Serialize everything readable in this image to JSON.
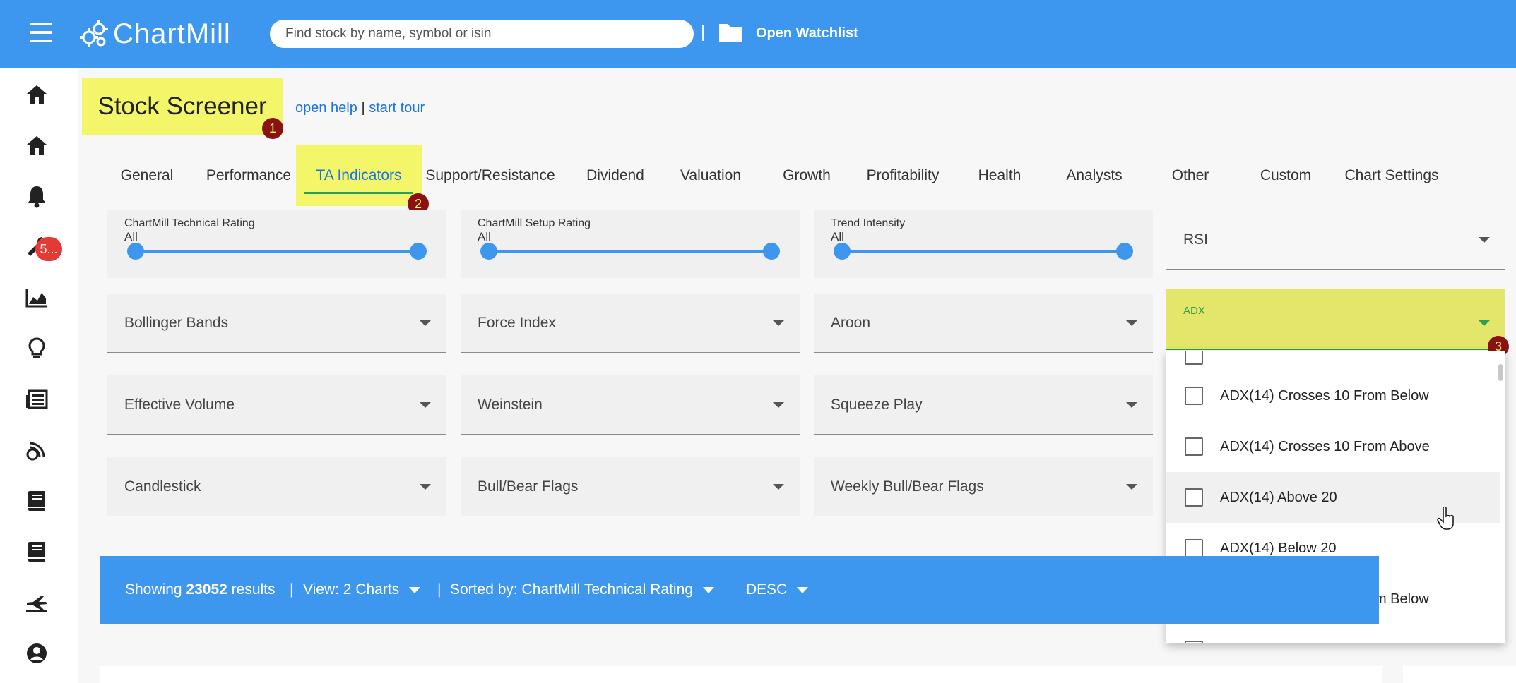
{
  "header": {
    "logo_text": "ChartMill",
    "search_placeholder": "Find stock by name, symbol or isin",
    "separator": "|",
    "open_watchlist": "Open Watchlist"
  },
  "sidebar": {
    "notifications_badge": "5...",
    "icons": [
      "home-icon",
      "home-icon",
      "bell-icon",
      "wrench-icon",
      "area-chart-icon",
      "lightbulb-icon",
      "newspaper-icon",
      "blog-icon",
      "book-icon",
      "book-icon",
      "plane-icon",
      "user-icon"
    ]
  },
  "page": {
    "title": "Stock Screener",
    "open_help": "open help",
    "separator": "|",
    "start_tour": "start tour",
    "markers": [
      "1",
      "2",
      "3"
    ]
  },
  "tabs": [
    "General",
    "Performance",
    "TA Indicators",
    "Support/Resistance",
    "Dividend",
    "Valuation",
    "Growth",
    "Profitability",
    "Health",
    "Analysts",
    "Other",
    "Custom",
    "Chart Settings"
  ],
  "active_tab": "TA Indicators",
  "sliders": [
    {
      "label": "ChartMill Technical Rating",
      "value": "All",
      "min_fraction": 0,
      "max_fraction": 1
    },
    {
      "label": "ChartMill Setup Rating",
      "value": "All",
      "min_fraction": 0,
      "max_fraction": 1
    },
    {
      "label": "Trend Intensity",
      "value": "All",
      "min_fraction": 0,
      "max_fraction": 1
    }
  ],
  "selects": {
    "rsi": "RSI",
    "row1": [
      "Bollinger Bands",
      "Force Index",
      "Aroon"
    ],
    "row2": [
      "Effective Volume",
      "Weinstein",
      "Squeeze Play"
    ],
    "row3": [
      "Candlestick",
      "Bull/Bear Flags",
      "Weekly Bull/Bear Flags"
    ],
    "adx_label": "ADX"
  },
  "adx_options": [
    "ADX(14) Crosses 10 From Below",
    "ADX(14) Crosses 10 From Above",
    "ADX(14) Above 20",
    "ADX(14) Below 20",
    "ADX(14) Crosses 20 From Below"
  ],
  "results": {
    "showing_prefix": "Showing",
    "count": "23052",
    "results_word": "results",
    "sep": "|",
    "view": "View: 2 Charts",
    "sorted": "Sorted by: ChartMill Technical Rating",
    "order": "DESC"
  },
  "colors": {
    "brand_blue": "#3d97ee",
    "highlight_yellow": "#f4f66a",
    "marker_red": "#8b1212",
    "active_green": "#2e9e4f"
  }
}
